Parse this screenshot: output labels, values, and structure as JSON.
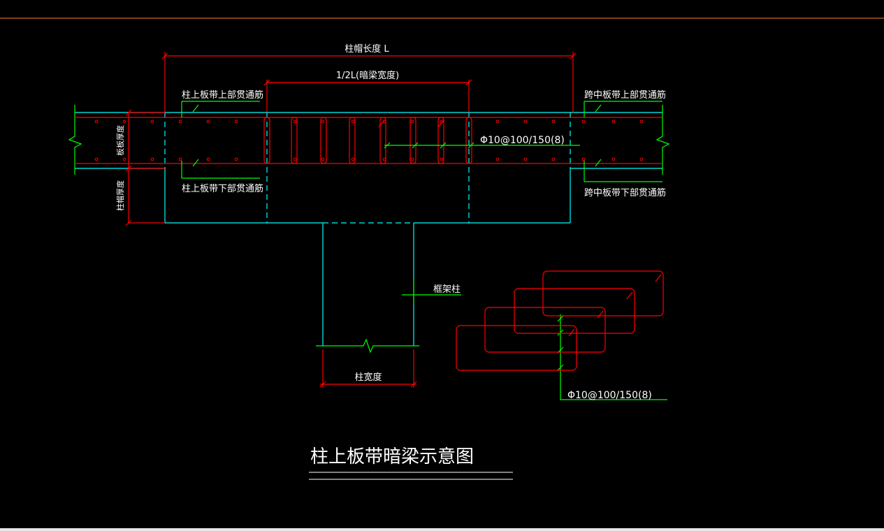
{
  "drawing": {
    "title": "柱上板带暗梁示意图",
    "labels": {
      "cap_length": "柱帽长度 L",
      "half_l": "1/2L(暗梁宽度)",
      "top_left": "柱上板带上部贯通筋",
      "bottom_left": "柱上板带下部贯通筋",
      "top_right": "跨中板带上部贯通筋",
      "bottom_right": "跨中板带下部贯通筋",
      "slab_thick": "板板厚度",
      "cap_thick": "柱帽厚度",
      "frame_col": "框架柱",
      "col_width": "柱宽度",
      "stirrup_main": "Φ10@100/150(8)",
      "stirrup_detail": "Φ10@100/150(8)"
    }
  },
  "colors": {
    "background": "#000000",
    "concrete": "#00ffff",
    "rebar": "#ff0000",
    "leader": "#00ff00",
    "text": "#ffffff",
    "top_rule": "#ff7f27"
  }
}
